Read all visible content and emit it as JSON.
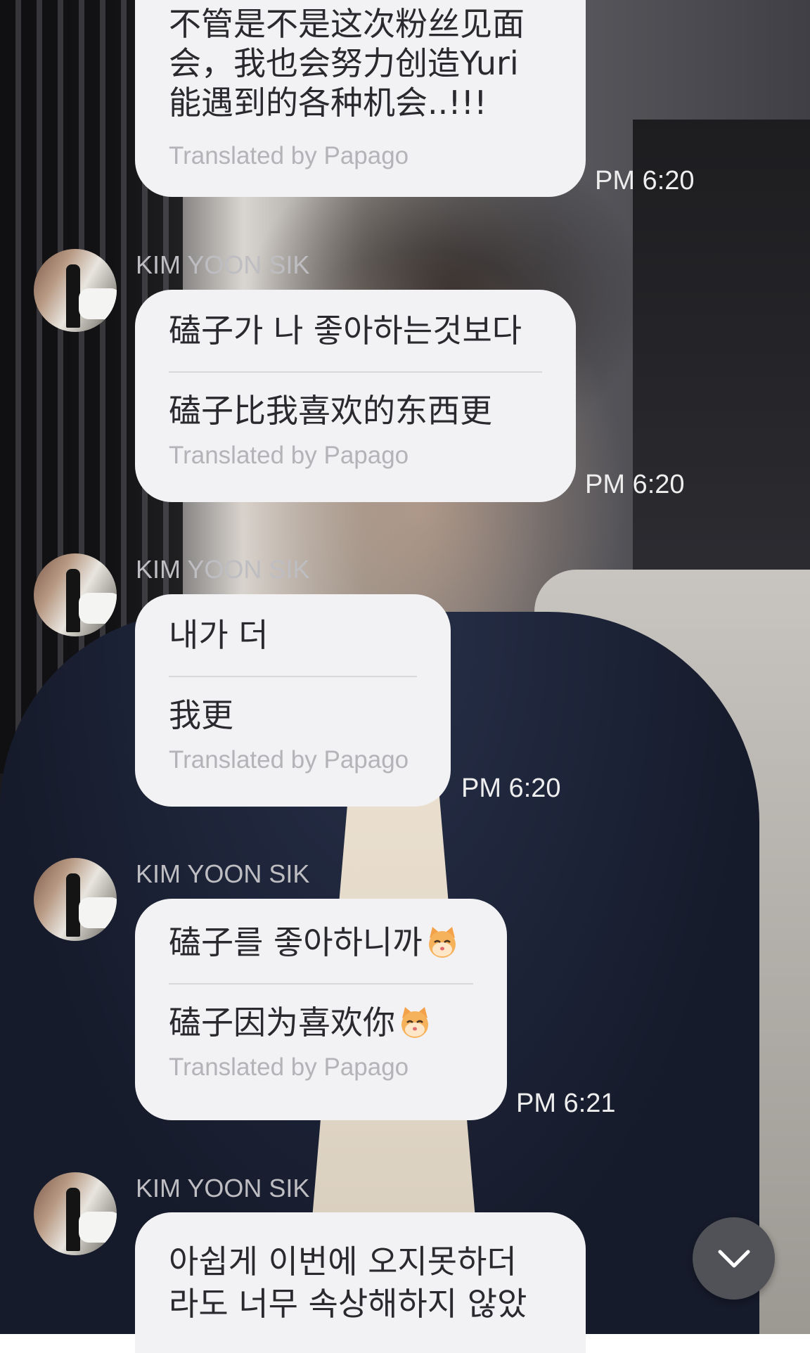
{
  "messages": [
    {
      "sender": "",
      "lines": [
        "不管是不是这次粉丝见面",
        "会，我也会努力创造Yuri",
        "能遇到的各种机会..!!!"
      ],
      "translation_note": "Translated by Papago",
      "time": "PM 6:20"
    },
    {
      "sender": "KIM YOON SIK",
      "original": "磕子가 나 좋아하는것보다",
      "translated": "磕子比我喜欢的东西更",
      "translation_note": "Translated by Papago",
      "time": "PM 6:20"
    },
    {
      "sender": "KIM YOON SIK",
      "original": "내가 더",
      "translated": "我更",
      "translation_note": "Translated by Papago",
      "time": "PM 6:20"
    },
    {
      "sender": "KIM YOON SIK",
      "original": "磕子를 좋아하니까",
      "translated": "磕子因为喜欢你",
      "original_emoji": "cat-kiss-emoji",
      "translated_emoji": "cat-kiss-emoji",
      "translation_note": "Translated by Papago",
      "time": "PM 6:21"
    },
    {
      "sender": "KIM YOON SIK",
      "lines": [
        "아쉽게 이번에 오지못하더",
        "라도 너무 속상해하지 않았"
      ]
    }
  ],
  "scroll_button": {
    "icon": "chevron-down-icon"
  },
  "colors": {
    "bubble": "#f2f2f4",
    "text": "#2a2a2e",
    "translation_note": "#b3b3b8",
    "sender": "#bdbdc2",
    "time": "#eeeeee",
    "scroll_button": "#505257"
  }
}
